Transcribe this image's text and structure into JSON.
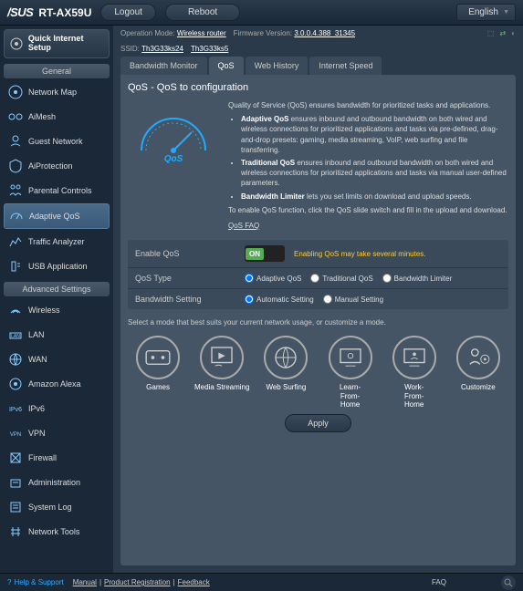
{
  "topbar": {
    "brand": "/SUS",
    "model": "RT-AX59U",
    "logout": "Logout",
    "reboot": "Reboot",
    "lang": "English"
  },
  "info": {
    "opmode_k": "Operation Mode:",
    "opmode_v": "Wireless router",
    "fw_k": "Firmware Version:",
    "fw_v": "3.0.0.4.388_31345",
    "ssid_k": "SSID:",
    "ssid1": "Th3G33ks24",
    "ssid2": "Th3G33ks5"
  },
  "sidebar": {
    "quick": "Quick Internet Setup",
    "general": "General",
    "items_g": [
      "Network Map",
      "AiMesh",
      "Guest Network",
      "AiProtection",
      "Parental Controls",
      "Adaptive QoS",
      "Traffic Analyzer",
      "USB Application"
    ],
    "advanced": "Advanced Settings",
    "items_a": [
      "Wireless",
      "LAN",
      "WAN",
      "Amazon Alexa",
      "IPv6",
      "VPN",
      "Firewall",
      "Administration",
      "System Log",
      "Network Tools"
    ]
  },
  "tabs": [
    "Bandwidth Monitor",
    "QoS",
    "Web History",
    "Internet Speed"
  ],
  "content": {
    "title": "QoS - QoS to configuration",
    "intro": "Quality of Service (QoS) ensures bandwidth for prioritized tasks and applications.",
    "b1": "Adaptive QoS",
    "d1": " ensures inbound and outbound bandwidth on both wired and wireless connections for prioritized applications and tasks via pre-defined, drag-and-drop presets: gaming, media streaming, VoIP, web surfing and file transferring.",
    "b2": "Traditional QoS",
    "d2": " ensures inbound and outbound bandwidth on both wired and wireless connections for prioritized applications and tasks via manual user-defined parameters.",
    "b3": "Bandwidth Limiter",
    "d3": " lets you set limits on download and upload speeds.",
    "enable_hint": "To enable QoS function, click the QoS slide switch and fill in the upload and download.",
    "faq": "QoS FAQ",
    "s1": "Enable QoS",
    "on": "ON",
    "warn": "Enabling QoS may take several minutes.",
    "s2": "QoS Type",
    "r1": "Adaptive QoS",
    "r2": "Traditional QoS",
    "r3": "Bandwidth Limiter",
    "s3": "Bandwidth Setting",
    "r4": "Automatic Setting",
    "r5": "Manual Setting",
    "hint": "Select a mode that best suits your current network usage, or customize a mode.",
    "modes": [
      "Games",
      "Media Streaming",
      "Web Surfing",
      "Learn-From-Home",
      "Work-From-Home",
      "Customize"
    ],
    "apply": "Apply"
  },
  "footer": {
    "hs": "Help & Support",
    "m": "Manual",
    "pr": "Product Registration",
    "fb": "Feedback",
    "faq": "FAQ"
  }
}
